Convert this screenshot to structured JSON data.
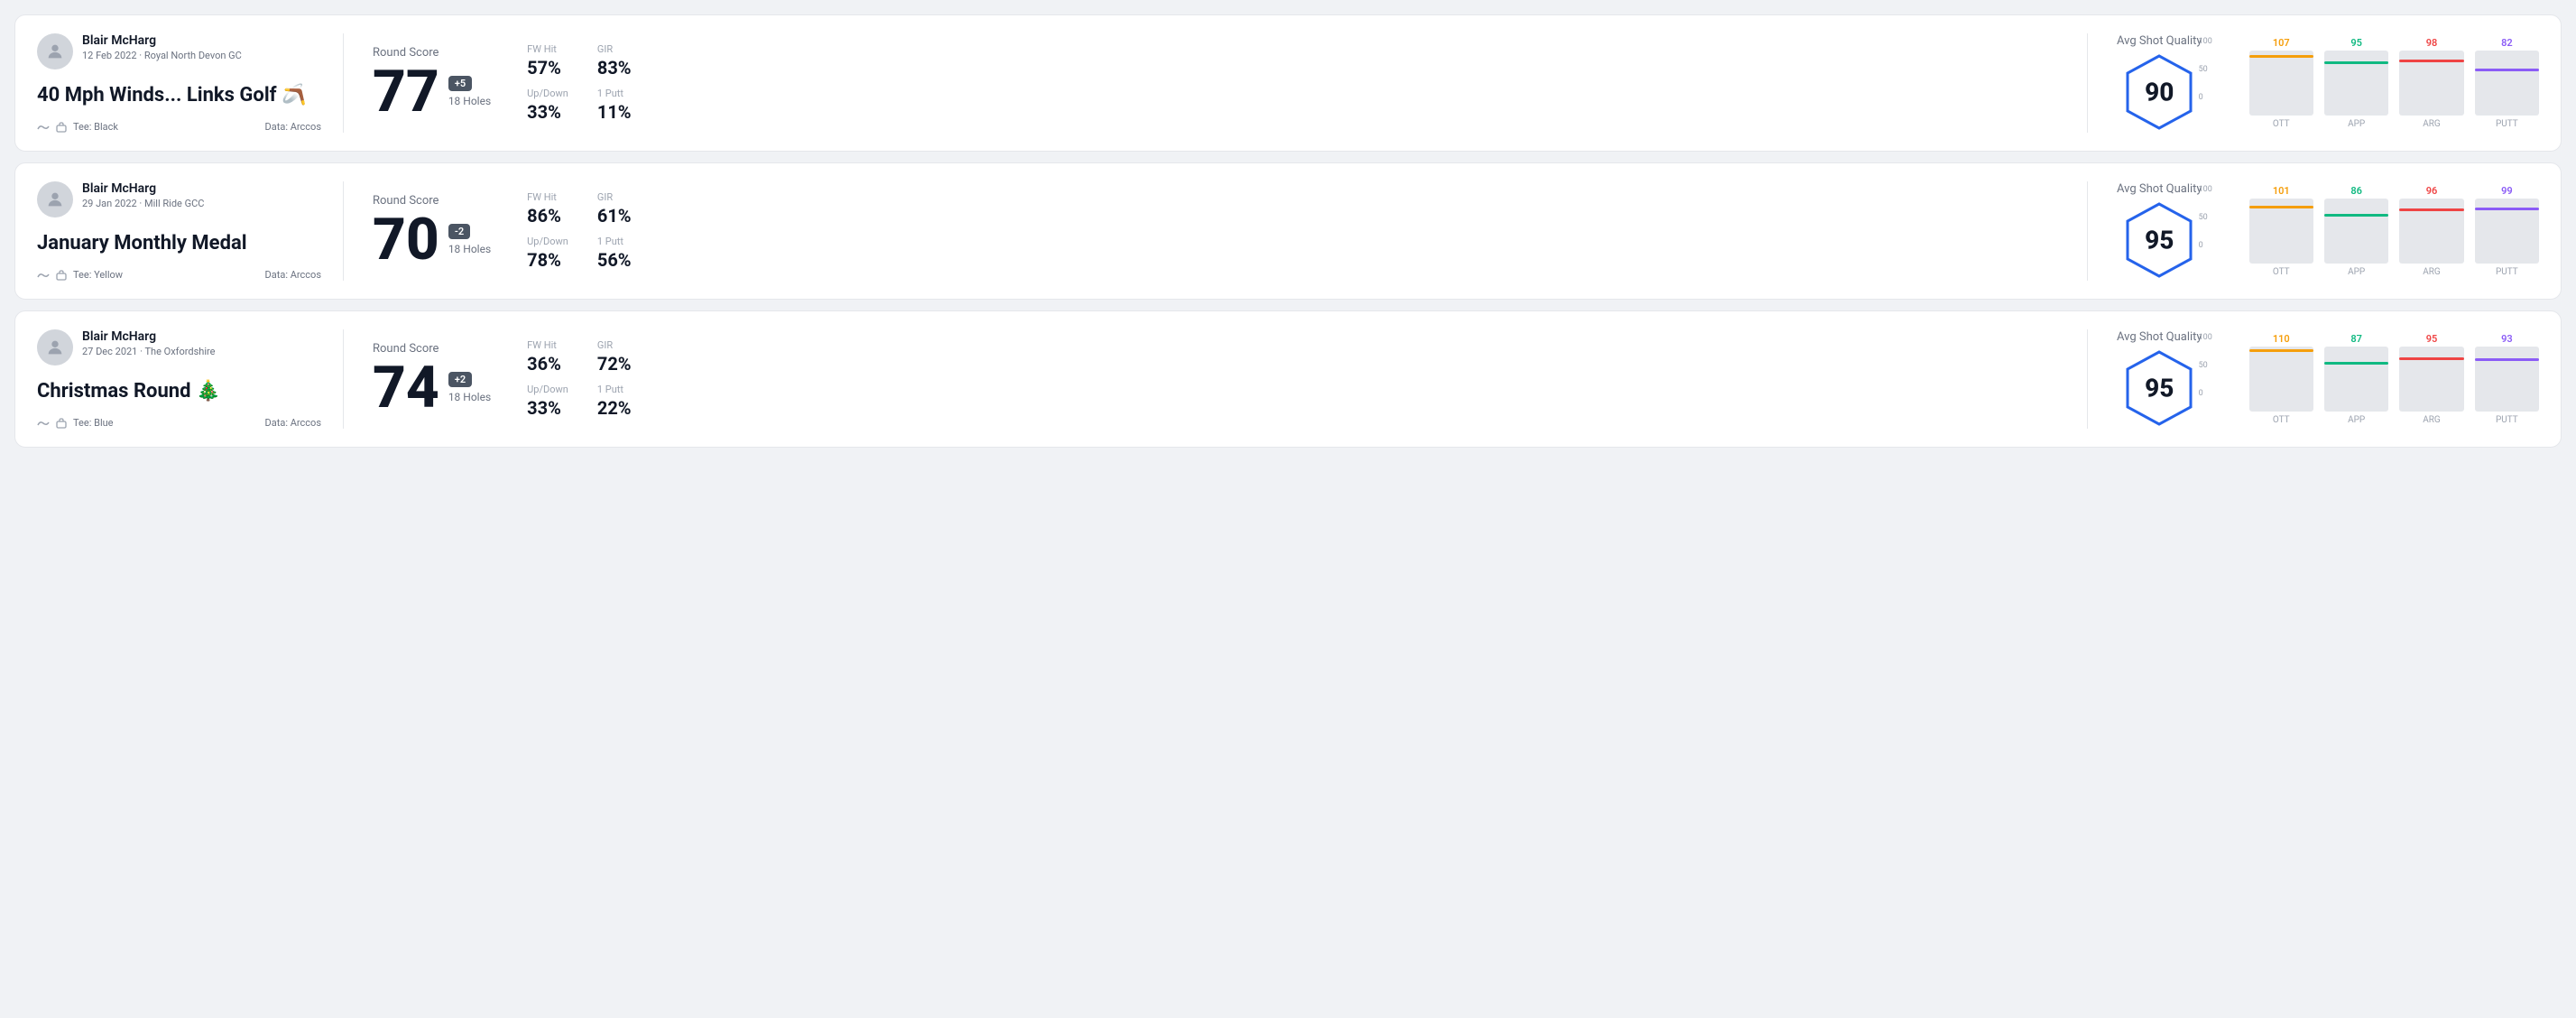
{
  "rounds": [
    {
      "id": "round-1",
      "user": {
        "name": "Blair McHarg",
        "meta": "12 Feb 2022 · Royal North Devon GC"
      },
      "title": "40 Mph Winds... Links Golf",
      "title_emoji": "🪃",
      "tee": "Black",
      "data_source": "Data: Arccos",
      "score": "77",
      "score_diff": "+5",
      "holes": "18 Holes",
      "fw_hit": "57%",
      "gir": "83%",
      "up_down": "33%",
      "one_putt": "11%",
      "avg_quality": "90",
      "chart": {
        "bars": [
          {
            "label": "OTT",
            "value": 107,
            "color": "#f59e0b"
          },
          {
            "label": "APP",
            "value": 95,
            "color": "#10b981"
          },
          {
            "label": "ARG",
            "value": 98,
            "color": "#ef4444"
          },
          {
            "label": "PUTT",
            "value": 82,
            "color": "#8b5cf6"
          }
        ]
      }
    },
    {
      "id": "round-2",
      "user": {
        "name": "Blair McHarg",
        "meta": "29 Jan 2022 · Mill Ride GCC"
      },
      "title": "January Monthly Medal",
      "title_emoji": "",
      "tee": "Yellow",
      "data_source": "Data: Arccos",
      "score": "70",
      "score_diff": "-2",
      "holes": "18 Holes",
      "fw_hit": "86%",
      "gir": "61%",
      "up_down": "78%",
      "one_putt": "56%",
      "avg_quality": "95",
      "chart": {
        "bars": [
          {
            "label": "OTT",
            "value": 101,
            "color": "#f59e0b"
          },
          {
            "label": "APP",
            "value": 86,
            "color": "#10b981"
          },
          {
            "label": "ARG",
            "value": 96,
            "color": "#ef4444"
          },
          {
            "label": "PUTT",
            "value": 99,
            "color": "#8b5cf6"
          }
        ]
      }
    },
    {
      "id": "round-3",
      "user": {
        "name": "Blair McHarg",
        "meta": "27 Dec 2021 · The Oxfordshire"
      },
      "title": "Christmas Round",
      "title_emoji": "🎄",
      "tee": "Blue",
      "data_source": "Data: Arccos",
      "score": "74",
      "score_diff": "+2",
      "holes": "18 Holes",
      "fw_hit": "36%",
      "gir": "72%",
      "up_down": "33%",
      "one_putt": "22%",
      "avg_quality": "95",
      "chart": {
        "bars": [
          {
            "label": "OTT",
            "value": 110,
            "color": "#f59e0b"
          },
          {
            "label": "APP",
            "value": 87,
            "color": "#10b981"
          },
          {
            "label": "ARG",
            "value": 95,
            "color": "#ef4444"
          },
          {
            "label": "PUTT",
            "value": 93,
            "color": "#8b5cf6"
          }
        ]
      }
    }
  ],
  "labels": {
    "round_score": "Round Score",
    "fw_hit": "FW Hit",
    "gir": "GIR",
    "up_down": "Up/Down",
    "one_putt": "1 Putt",
    "avg_quality": "Avg Shot Quality"
  }
}
